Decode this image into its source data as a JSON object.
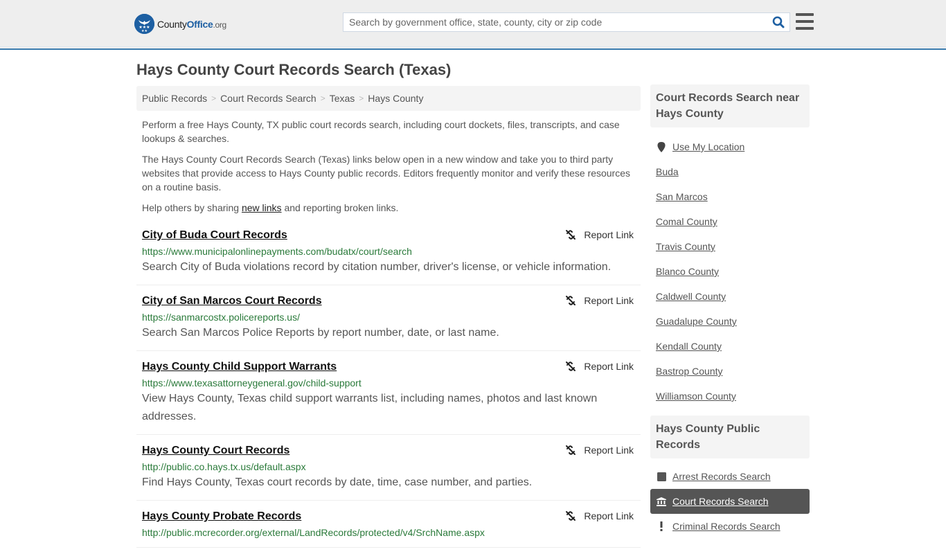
{
  "header": {
    "logo": {
      "part1": "County",
      "part2": "Office",
      "part3": ".org"
    },
    "search": {
      "placeholder": "Search by government office, state, county, city or zip code",
      "value": ""
    }
  },
  "page": {
    "title": "Hays County Court Records Search (Texas)"
  },
  "breadcrumb": [
    {
      "label": "Public Records"
    },
    {
      "label": "Court Records Search"
    },
    {
      "label": "Texas"
    },
    {
      "label": "Hays County"
    }
  ],
  "breadcrumb_separator": ">",
  "intro": {
    "p1": "Perform a free Hays County, TX public court records search, including court dockets, files, transcripts, and case lookups & searches.",
    "p2": "The Hays County Court Records Search (Texas) links below open in a new window and take you to third party websites that provide access to Hays County public records. Editors frequently monitor and verify these resources on a routine basis.",
    "p3_before": "Help others by sharing ",
    "p3_link": "new links",
    "p3_after": " and reporting broken links."
  },
  "report_label": "Report Link",
  "results": [
    {
      "title": "City of Buda Court Records",
      "url": "https://www.municipalonlinepayments.com/budatx/court/search",
      "desc": "Search City of Buda violations record by citation number, driver's license, or vehicle information."
    },
    {
      "title": "City of San Marcos Court Records",
      "url": "https://sanmarcostx.policereports.us/",
      "desc": "Search San Marcos Police Reports by report number, date, or last name."
    },
    {
      "title": "Hays County Child Support Warrants",
      "url": "https://www.texasattorneygeneral.gov/child-support",
      "desc": "View Hays County, Texas child support warrants list, including names, photos and last known addresses."
    },
    {
      "title": "Hays County Court Records",
      "url": "http://public.co.hays.tx.us/default.aspx",
      "desc": "Find Hays County, Texas court records by date, time, case number, and parties."
    },
    {
      "title": "Hays County Probate Records",
      "url": "http://public.mcrecorder.org/external/LandRecords/protected/v4/SrchName.aspx",
      "desc": ""
    }
  ],
  "sidebar": {
    "nearby": {
      "heading": "Court Records Search near Hays County",
      "use_location": "Use My Location",
      "items": [
        "Buda",
        "San Marcos",
        "Comal County",
        "Travis County",
        "Blanco County",
        "Caldwell County",
        "Guadalupe County",
        "Kendall County",
        "Bastrop County",
        "Williamson County"
      ]
    },
    "public_records": {
      "heading": "Hays County Public Records",
      "items": [
        {
          "label": "Arrest Records Search",
          "icon": "square-icon",
          "active": false
        },
        {
          "label": "Court Records Search",
          "icon": "courthouse-icon",
          "active": true
        },
        {
          "label": "Criminal Records Search",
          "icon": "exclamation-icon",
          "active": false
        }
      ]
    }
  },
  "colors": {
    "accent": "#3a7cae",
    "brand": "#1d5fa2",
    "url_green": "#2a7a3a",
    "active_bg": "#555555"
  }
}
